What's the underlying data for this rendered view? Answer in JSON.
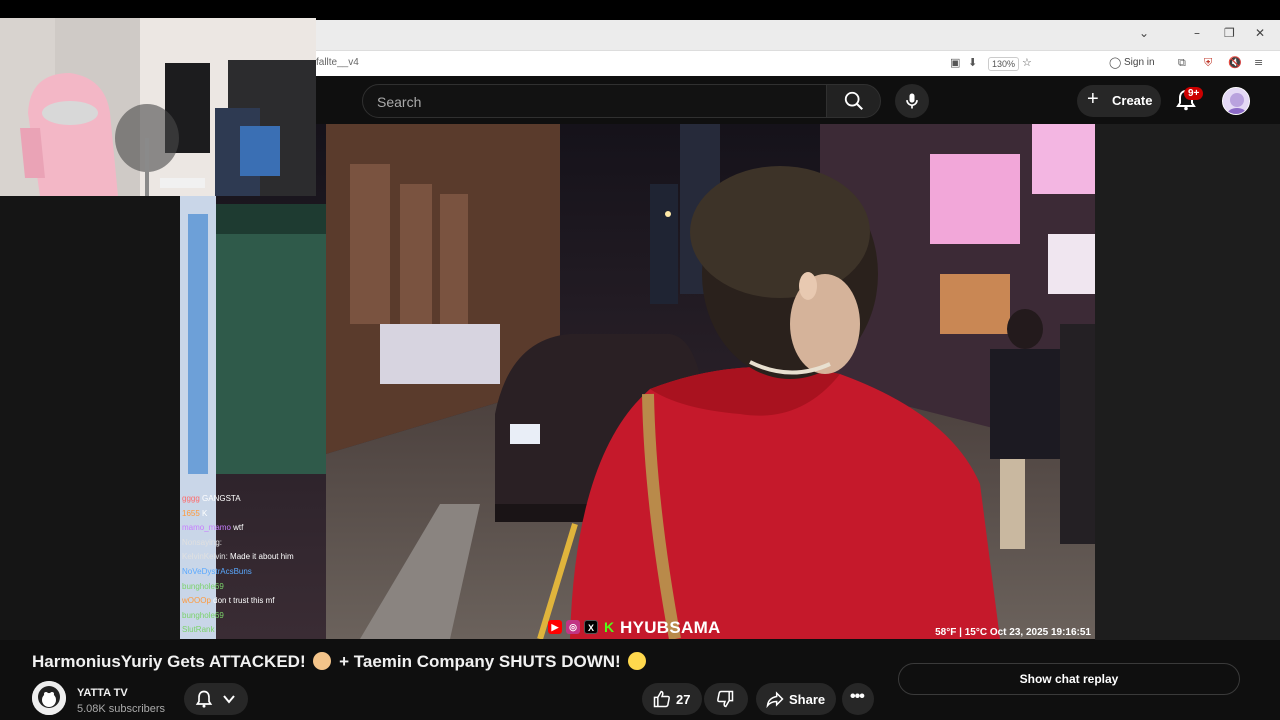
{
  "browser": {
    "url_fragment": "fallte__v4",
    "zoom": "130%",
    "sign_in": "Sign in"
  },
  "header": {
    "search_placeholder": "Search",
    "create_label": "Create",
    "notification_count": "9+"
  },
  "video": {
    "watermark": "HYUBSAMA",
    "hud": "58°F | 15°C   Oct 23, 2025   19:16:51",
    "chat": [
      {
        "user": "gggg",
        "text": "GANGSTA",
        "color": "#ff6b6b"
      },
      {
        "user": "1655",
        "text": "K",
        "color": "#ff9a3c"
      },
      {
        "user": "mamo_mamo",
        "text": "wtf",
        "color": "#c77dff"
      },
      {
        "user": "Nonsaying:",
        "text": "",
        "color": "#e0e0e0"
      },
      {
        "user": "KelvinKelvin:",
        "text": "Made it about him",
        "color": "#e0e0e0"
      },
      {
        "user": "NoVeDystrAcsBuns",
        "text": "",
        "color": "#5aa9ff"
      },
      {
        "user": "bunghole69",
        "text": "",
        "color": "#7bd36b"
      },
      {
        "user": "wOOOp",
        "text": "don t trust this mf",
        "color": "#ff9a3c"
      },
      {
        "user": "bunghole69",
        "text": "",
        "color": "#7bd36b"
      },
      {
        "user": "SlutRank",
        "text": "",
        "color": "#7bd36b"
      }
    ]
  },
  "details": {
    "title": "HarmoniusYuriy Gets ATTACKED! 🥶 + Taemin Company SHUTS DOWN! 😱",
    "title_part1": "HarmoniusYuriy Gets ATTACKED!",
    "title_part2": "+ Taemin Company SHUTS DOWN!",
    "channel_name": "YATTA TV",
    "subscribers": "5.08K subscribers",
    "like_count": "27",
    "share_label": "Share",
    "show_chat_replay": "Show chat replay"
  },
  "colors": {
    "yt_bg": "#0f0f0f",
    "pill_bg": "#272727",
    "notification_red": "#cc0000"
  }
}
